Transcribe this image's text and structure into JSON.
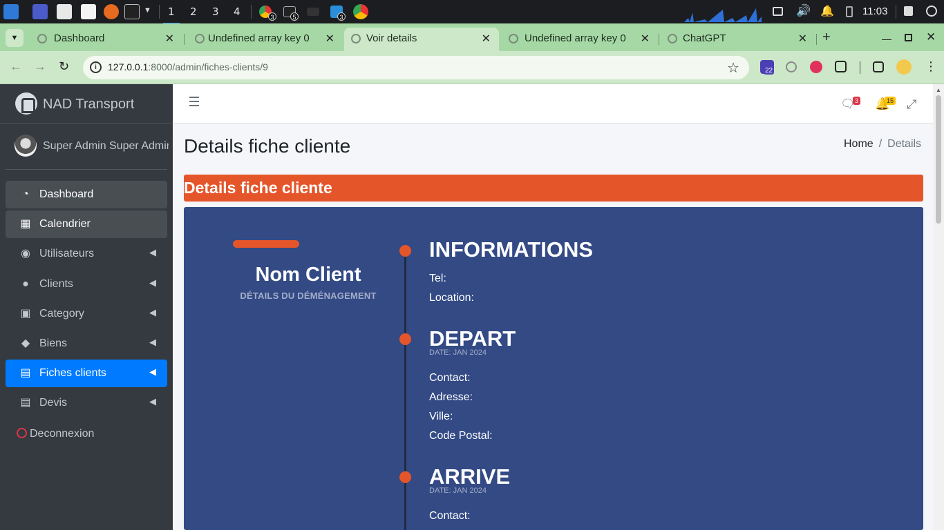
{
  "taskbar": {
    "workspaces": [
      "1",
      "2",
      "3",
      "4"
    ],
    "badges": [
      "3",
      "5",
      "3"
    ],
    "clock": "11:03"
  },
  "browser": {
    "tabs": [
      {
        "title": "Dashboard",
        "active": false
      },
      {
        "title": "Undefined array key 0",
        "active": false
      },
      {
        "title": "Voir details",
        "active": true
      },
      {
        "title": "Undefined array key 0",
        "active": false
      },
      {
        "title": "ChatGPT",
        "active": false
      }
    ],
    "url_host": "127.0.0.1",
    "url_rest": ":8000/admin/fiches-clients/9",
    "ext_badge": "22"
  },
  "sidebar": {
    "brand": "NAD Transport",
    "user": "Super Admin Super Admin",
    "items": [
      {
        "label": "Dashboard",
        "icon": "tachometer-icon",
        "has_chevron": false,
        "state": "soft"
      },
      {
        "label": "Calendrier",
        "icon": "calendar-icon",
        "has_chevron": false,
        "state": "soft"
      },
      {
        "label": "Utilisateurs",
        "icon": "users-icon",
        "has_chevron": true,
        "state": ""
      },
      {
        "label": "Clients",
        "icon": "user-icon",
        "has_chevron": true,
        "state": ""
      },
      {
        "label": "Category",
        "icon": "cart-icon",
        "has_chevron": true,
        "state": ""
      },
      {
        "label": "Biens",
        "icon": "tag-icon",
        "has_chevron": true,
        "state": ""
      },
      {
        "label": "Fiches clients",
        "icon": "book-icon",
        "has_chevron": true,
        "state": "active"
      },
      {
        "label": "Devis",
        "icon": "book-icon",
        "has_chevron": true,
        "state": ""
      }
    ],
    "logout": "Deconnexion"
  },
  "topnav": {
    "messages_count": "3",
    "notifications_count": "15"
  },
  "content": {
    "page_title": "Details fiche cliente",
    "breadcrumb": {
      "home": "Home",
      "current": "Details"
    },
    "card_header": "Details fiche cliente",
    "client_name": "Nom Client",
    "client_subtitle": "DÉTAILS DU DÉMÉNAGEMENT",
    "informations": {
      "title": "INFORMATIONS",
      "tel_label": "Tel:",
      "location_label": "Location:"
    },
    "depart": {
      "title": "DEPART",
      "date": "DATE: JAN 2024",
      "contact_label": "Contact:",
      "adresse_label": "Adresse:",
      "ville_label": "Ville:",
      "cp_label": "Code Postal:"
    },
    "arrive": {
      "title": "ARRIVE",
      "date": "DATE: JAN 2024",
      "contact_label": "Contact:"
    }
  },
  "colors": {
    "accent_orange": "#e5552a",
    "card_blue": "#334a85",
    "sidebar_bg": "#343a40",
    "active_blue": "#007bff"
  }
}
